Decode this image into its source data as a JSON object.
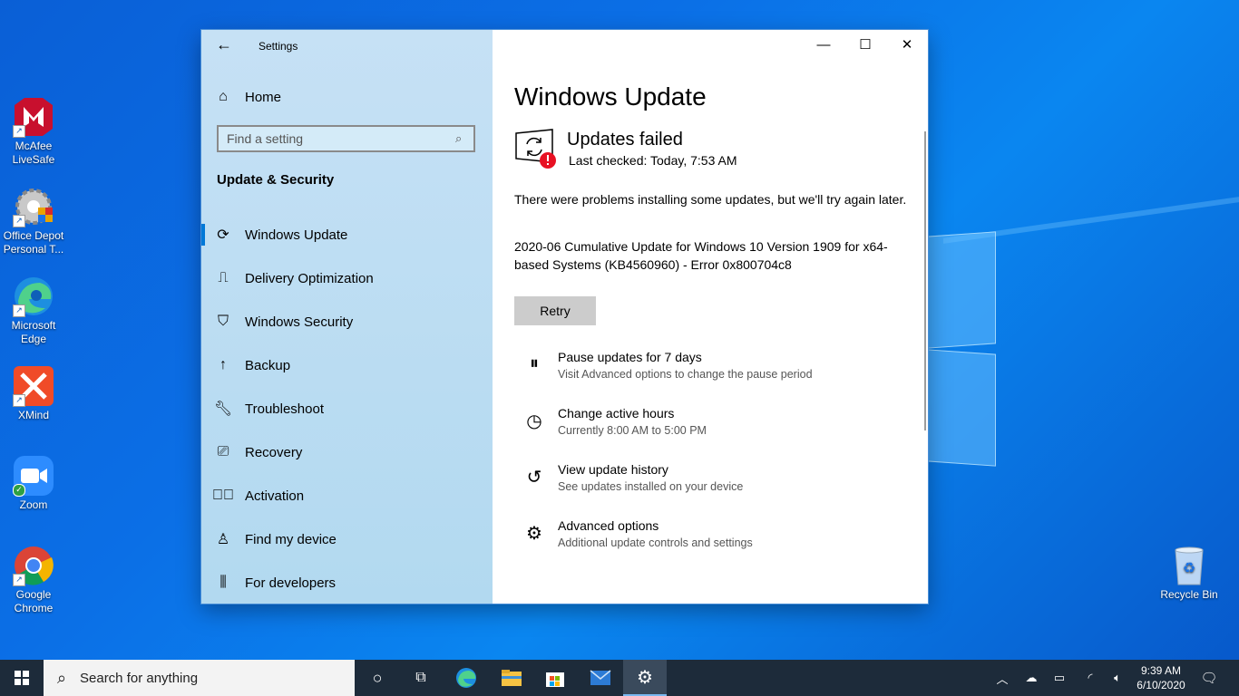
{
  "desktop": {
    "icons": [
      {
        "label": "McAfee LiveSafe"
      },
      {
        "label": "Office Depot Personal T..."
      },
      {
        "label": "Microsoft Edge"
      },
      {
        "label": "XMind"
      },
      {
        "label": "Zoom"
      },
      {
        "label": "Google Chrome"
      },
      {
        "label": "Recycle Bin"
      }
    ]
  },
  "window": {
    "title": "Settings",
    "controls": {
      "minimize": "—",
      "maximize": "☐",
      "close": "✕"
    }
  },
  "nav": {
    "home": "Home",
    "search_placeholder": "Find a setting",
    "section": "Update & Security",
    "items": [
      {
        "label": "Windows Update",
        "icon": "sync-icon"
      },
      {
        "label": "Delivery Optimization",
        "icon": "delivery-icon"
      },
      {
        "label": "Windows Security",
        "icon": "shield-icon"
      },
      {
        "label": "Backup",
        "icon": "backup-icon"
      },
      {
        "label": "Troubleshoot",
        "icon": "wrench-icon"
      },
      {
        "label": "Recovery",
        "icon": "recovery-icon"
      },
      {
        "label": "Activation",
        "icon": "check-circle-icon"
      },
      {
        "label": "Find my device",
        "icon": "person-icon"
      },
      {
        "label": "For developers",
        "icon": "developer-icon"
      }
    ]
  },
  "content": {
    "title": "Windows Update",
    "status_title": "Updates failed",
    "status_sub": "Last checked: Today, 7:53 AM",
    "message": "There were problems installing some updates, but we'll try again later.",
    "update_detail": "2020-06 Cumulative Update for Windows 10 Version 1909 for x64-based Systems (KB4560960) - Error 0x800704c8",
    "retry_label": "Retry",
    "options": [
      {
        "title": "Pause updates for 7 days",
        "sub": "Visit Advanced options to change the pause period"
      },
      {
        "title": "Change active hours",
        "sub": "Currently 8:00 AM to 5:00 PM"
      },
      {
        "title": "View update history",
        "sub": "See updates installed on your device"
      },
      {
        "title": "Advanced options",
        "sub": "Additional update controls and settings"
      }
    ]
  },
  "taskbar": {
    "search_text": "Search for anything",
    "time": "9:39 AM",
    "date": "6/10/2020"
  },
  "colors": {
    "accent": "#0078d7",
    "error": "#e81123",
    "taskbar": "#1d2b3a"
  }
}
